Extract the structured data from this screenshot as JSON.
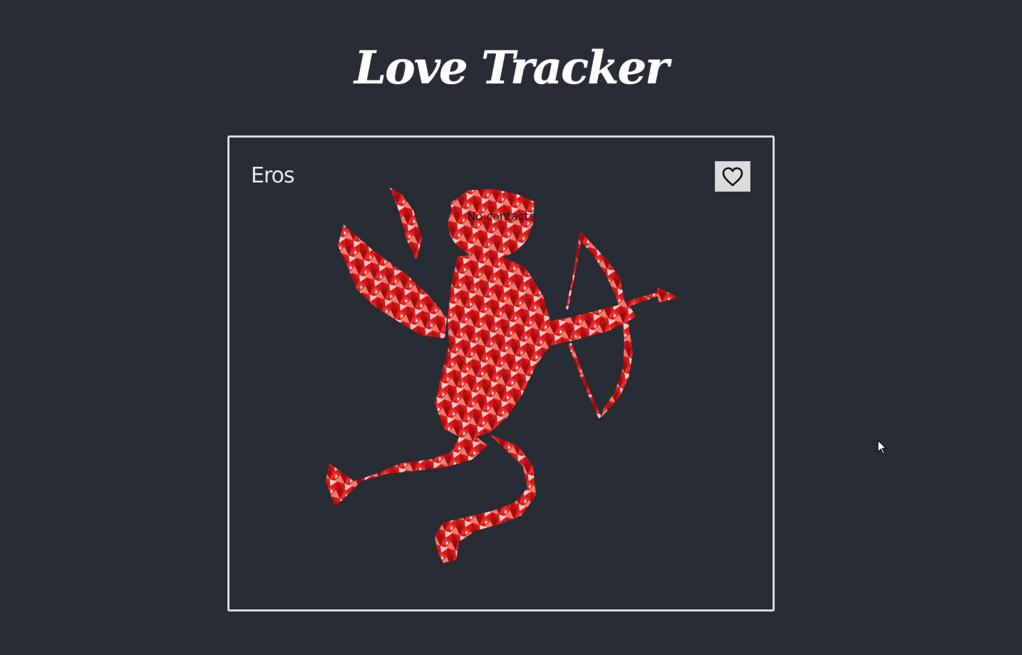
{
  "app": {
    "title": "Love Tracker"
  },
  "card": {
    "name": "Eros",
    "empty_text": "No contacts",
    "heart_icon": "heart-outline-icon",
    "illustration": "cupid-illustration"
  },
  "colors": {
    "background": "#282c34",
    "card_border": "#d9d9d9",
    "button_bg": "#dcdcdc",
    "cupid_red": "#d4181a"
  }
}
